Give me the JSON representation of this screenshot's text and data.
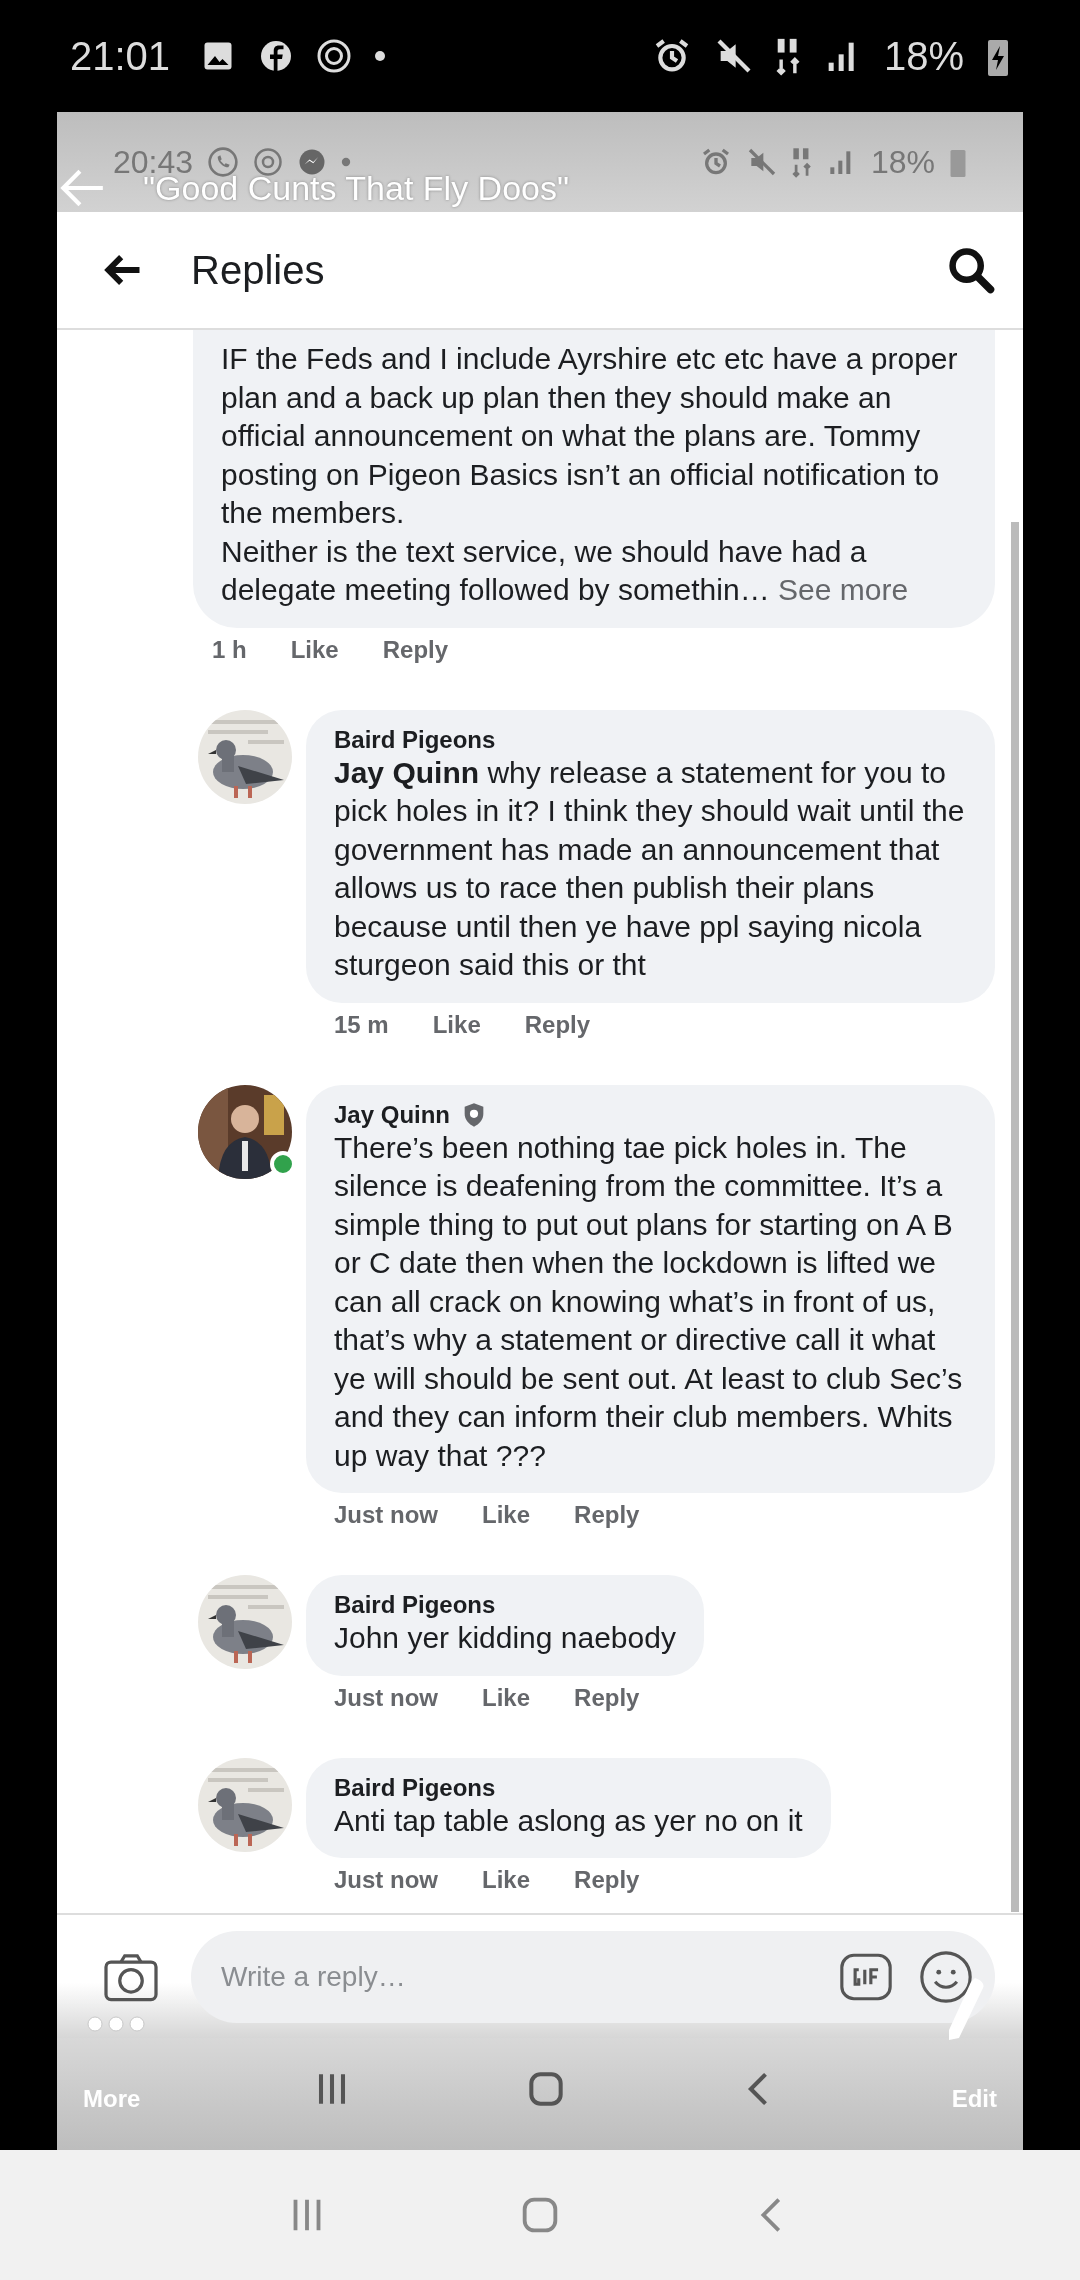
{
  "status_bar": {
    "time": "21:01",
    "battery": "18%"
  },
  "viewer": {
    "title": "\"Good Cunts That Fly Doos\"",
    "inner_status_bar": {
      "time": "20:43",
      "battery": "18%"
    }
  },
  "header": {
    "title": "Replies"
  },
  "comments": [
    {
      "kind": "parent",
      "paragraphs": [
        "IF the Feds and I include Ayrshire etc etc have a proper plan and a back up plan then they should make an official announcement on  what the plans are. Tommy posting on Pigeon Basics isn’t an official notification to the members.",
        "Neither is the text service, we should have had a delegate meeting followed by somethin…"
      ],
      "see_more": "See more",
      "time": "1 h",
      "like": "Like",
      "reply": "Reply"
    },
    {
      "kind": "reply",
      "author": "Baird Pigeons",
      "verified": false,
      "online": false,
      "text": "**Jay Quinn** why release a statement for you to pick holes in it? I think they should wait until the government has made an announcement that allows us to race then publish their plans because until then ye have ppl saying nicola sturgeon said this or tht",
      "time": "15 m",
      "like": "Like",
      "reply": "Reply"
    },
    {
      "kind": "reply",
      "author": "Jay Quinn",
      "verified": true,
      "online": true,
      "text": "There’s been nothing tae pick holes in. The silence is deafening from the committee. It’s a simple thing to put out plans for starting on A B or C date then when the lockdown is lifted we can all crack on knowing what’s in front of us, that’s why a statement or directive call it what ye will should be sent out. At least to club Sec’s and they can inform their club members. Whits up way that ???",
      "time": "Just now",
      "like": "Like",
      "reply": "Reply"
    },
    {
      "kind": "reply",
      "author": "Baird Pigeons",
      "verified": false,
      "online": false,
      "text": "John yer kidding naebody",
      "time": "Just now",
      "like": "Like",
      "reply": "Reply"
    },
    {
      "kind": "reply",
      "author": "Baird Pigeons",
      "verified": false,
      "online": false,
      "text": "Anti tap table aslong as yer no on it",
      "time": "Just now",
      "like": "Like",
      "reply": "Reply"
    }
  ],
  "composer": {
    "placeholder": "Write a reply…"
  },
  "viewer_toolbar": {
    "more": "More",
    "edit": "Edit"
  }
}
